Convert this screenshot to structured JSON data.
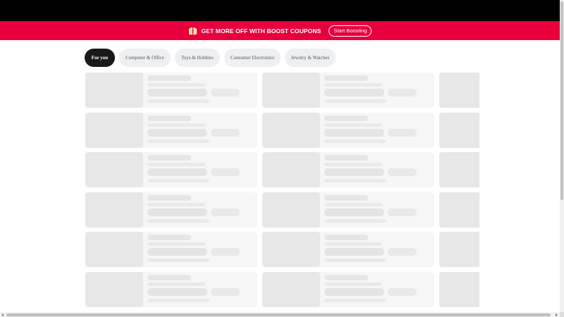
{
  "promo_banner": {
    "icon": "gift-coupon-icon",
    "text": "GET MORE OFF WITH BOOST COUPONS",
    "button_label": "Start Boosting",
    "background_color": "#e8003d"
  },
  "category_tabs": [
    {
      "label": "For you",
      "active": true
    },
    {
      "label": "Computer & Office",
      "active": false
    },
    {
      "label": "Toys & Hobbies",
      "active": false
    },
    {
      "label": "Consumer Electronics",
      "active": false
    },
    {
      "label": "Jewelry & Watches",
      "active": false
    }
  ],
  "product_grid": {
    "state": "loading-skeleton",
    "rows": 6,
    "columns": 3
  },
  "colors": {
    "top_bar": "#000000",
    "active_tab": "#191919",
    "inactive_tab": "#eeeff3",
    "skeleton": "#e7e7e7"
  }
}
